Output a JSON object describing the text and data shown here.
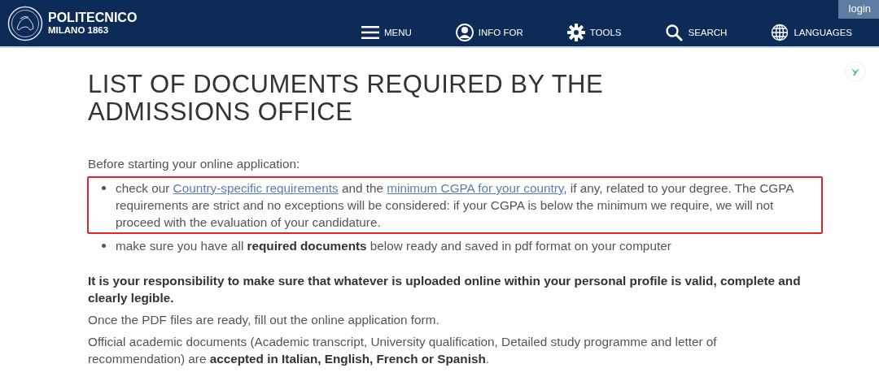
{
  "header": {
    "logo_title": "POLITECNICO",
    "logo_subtitle": "MILANO 1863",
    "login": "login",
    "nav": [
      {
        "kind": "menu",
        "label": "MENU"
      },
      {
        "kind": "person",
        "label": "INFO FOR"
      },
      {
        "kind": "gear",
        "label": "TOOLS"
      },
      {
        "kind": "search",
        "label": "SEARCH"
      },
      {
        "kind": "globe",
        "label": "LANGUAGES"
      }
    ]
  },
  "page": {
    "title": "LIST OF DOCUMENTS REQUIRED BY THE ADMISSIONS OFFICE",
    "intro": "Before starting your online application:",
    "bullets": [
      {
        "highlighted": true,
        "parts": [
          {
            "kind": "text",
            "text": "check our "
          },
          {
            "kind": "link",
            "text": "Country-specific requirements"
          },
          {
            "kind": "text",
            "text": " and the "
          },
          {
            "kind": "link",
            "text": "minimum CGPA for your country"
          },
          {
            "kind": "text",
            "text": ", if any, related to your degree. The CGPA requirements are strict and no exceptions will be considered: if your CGPA is below the minimum we require, we will not proceed with the evaluation of your candidature."
          }
        ]
      },
      {
        "highlighted": false,
        "parts": [
          {
            "kind": "text",
            "text": "make sure you have all **required documents** below ready and saved in pdf format on your computer"
          }
        ]
      }
    ],
    "paragraphs": [
      {
        "bold": true,
        "text": "It is your responsibility to make sure that whatever is uploaded online within your personal profile is valid, complete and clearly legible."
      },
      {
        "bold": false,
        "text": "Once the PDF files are ready, fill out the online application form."
      },
      {
        "bold": false,
        "text": "Official academic documents (Academic transcript, University qualification, Detailed study programme and letter of recommendation) are **accepted in Italian, English, French or Spanish**."
      }
    ]
  }
}
